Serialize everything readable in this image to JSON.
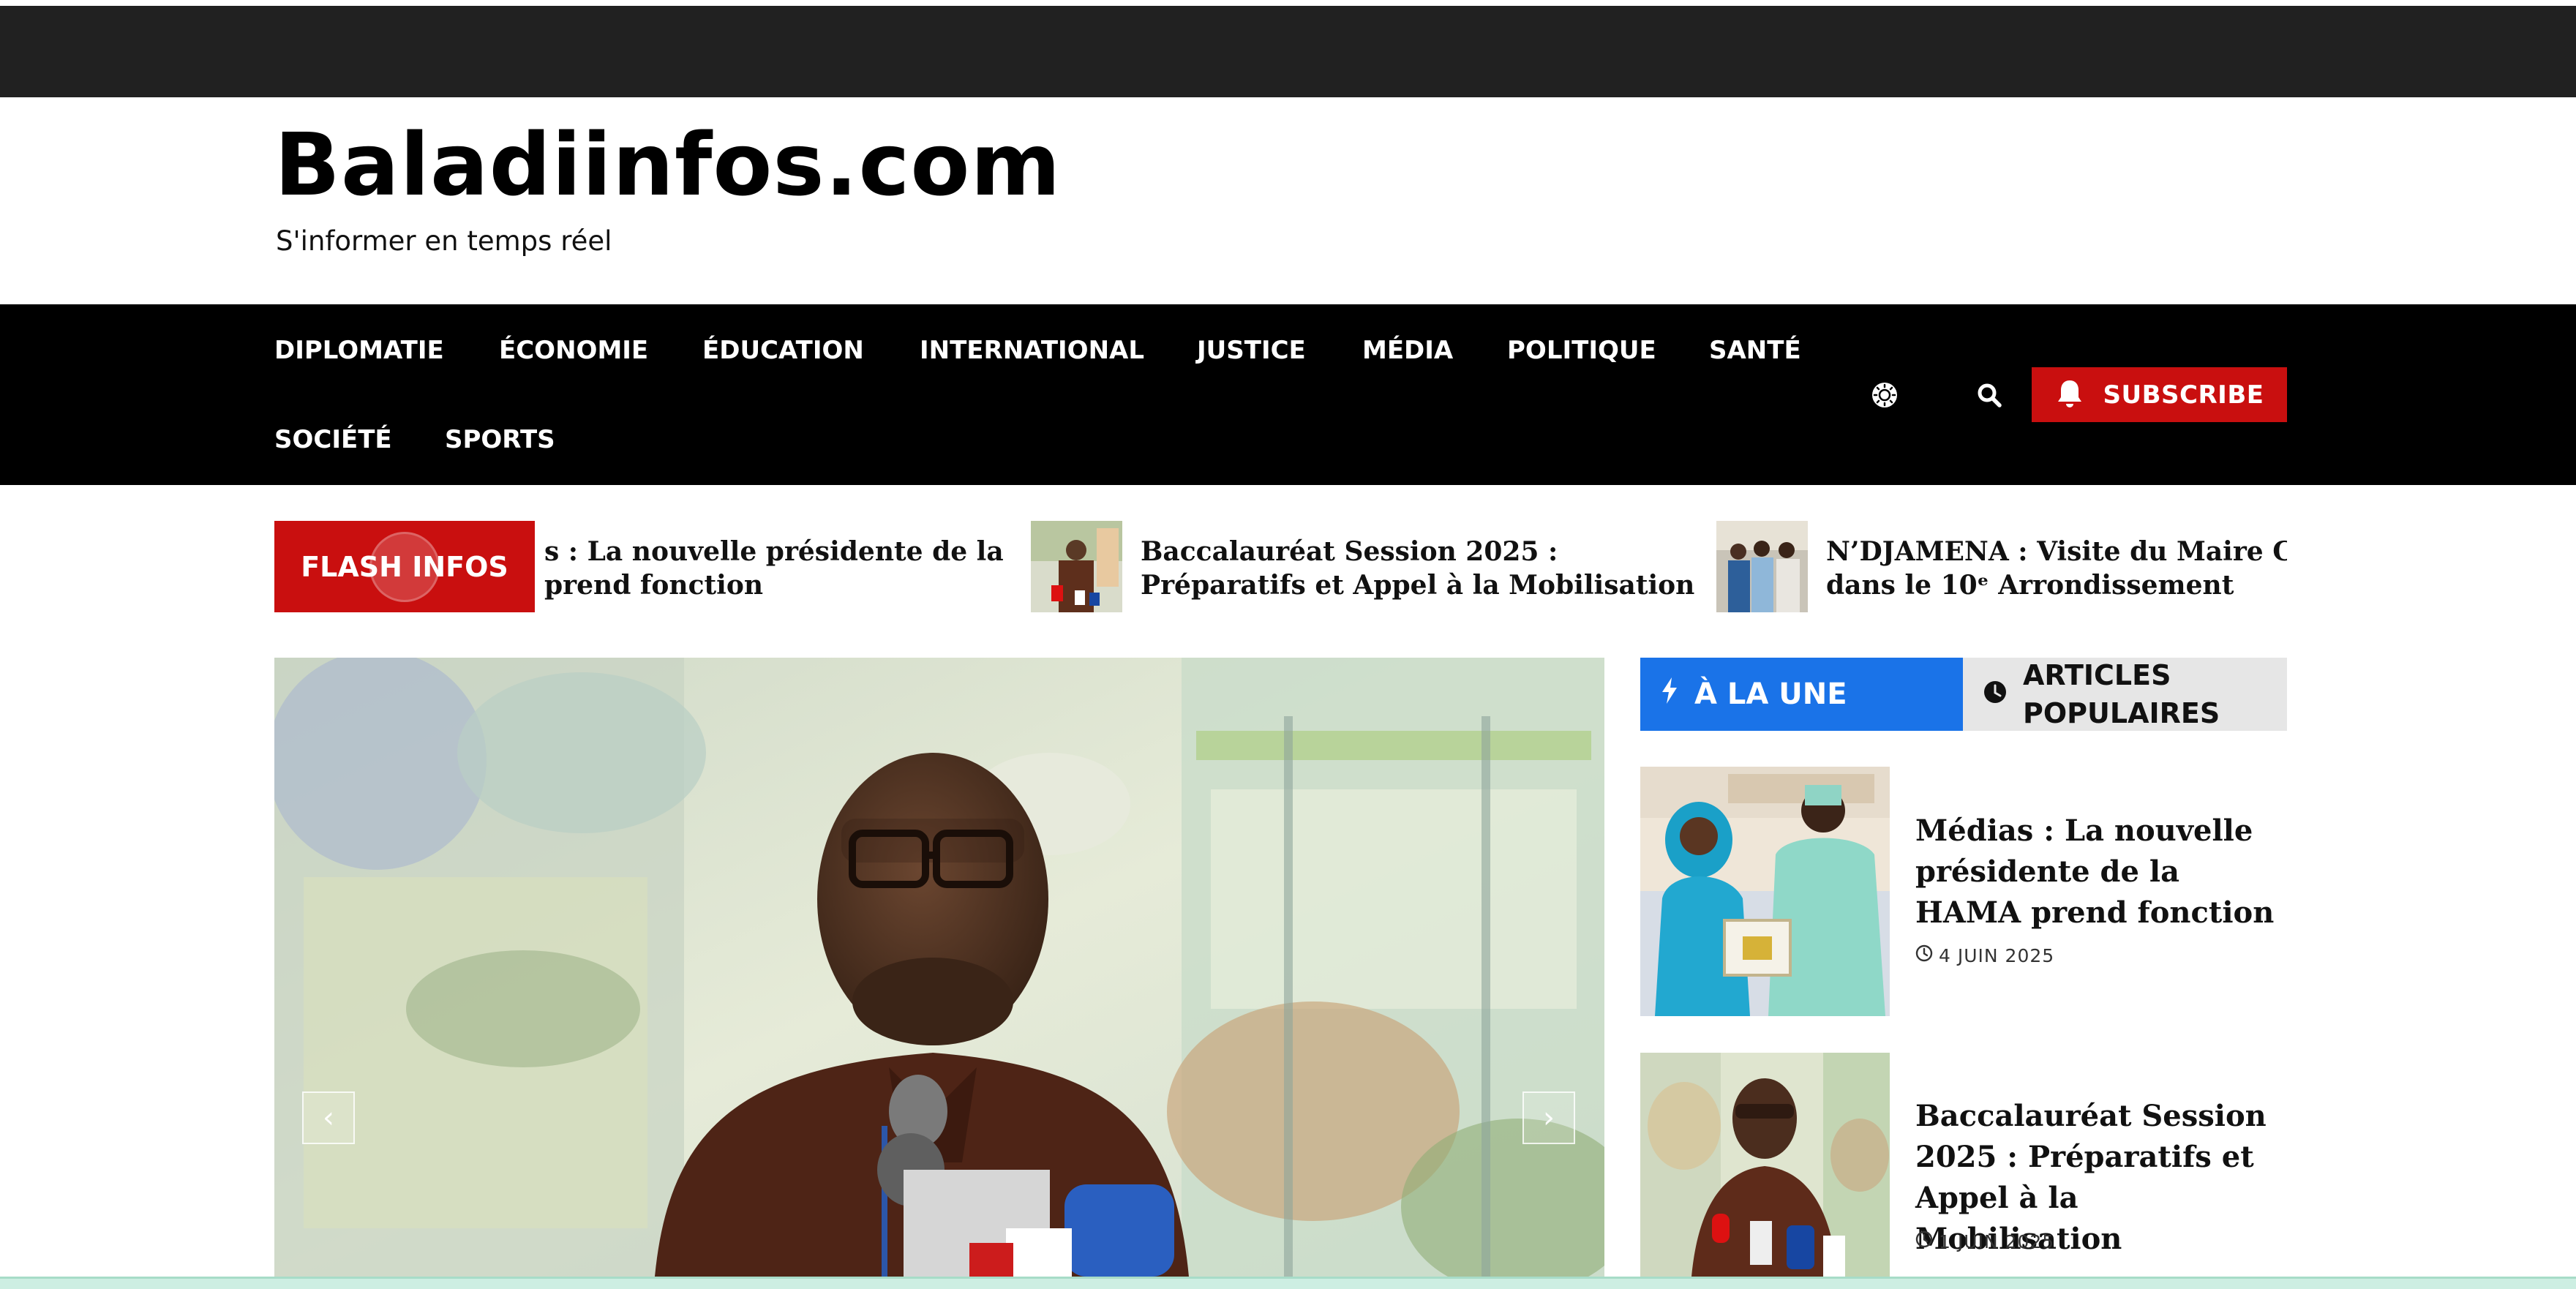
{
  "site": {
    "title": "Baladiinfos.com",
    "tagline": "S'informer en temps réel"
  },
  "nav": {
    "items": [
      "DIPLOMATIE",
      "ÉCONOMIE",
      "ÉDUCATION",
      "INTERNATIONAL",
      "JUSTICE",
      "MÉDIA",
      "POLITIQUE",
      "SANTÉ",
      "SOCIÉTÉ",
      "SPORTS"
    ],
    "theme_icon": "sun-icon",
    "search_icon": "search-icon",
    "subscribe_icon": "bell-icon",
    "subscribe_label": "SUBSCRIBE"
  },
  "flash": {
    "label": "FLASH INFOS",
    "items": [
      {
        "line1": "s : La nouvelle présidente de la",
        "line2": "prend fonction"
      },
      {
        "line1": "Baccalauréat Session 2025 :",
        "line2": "Préparatifs et Appel à la Mobilisation"
      },
      {
        "line1": "N’DJAMENA : Visite du Maire Central",
        "line2": "dans le 10ᵉ Arrondissement"
      }
    ]
  },
  "slider": {
    "prev_icon": "chevron-left-icon",
    "next_icon": "chevron-right-icon"
  },
  "sidebar": {
    "tab_active": "À LA UNE",
    "tab_active_icon": "bolt-icon",
    "tab_inactive": "ARTICLES POPULAIRES",
    "tab_inactive_icon": "clock-icon",
    "articles": [
      {
        "title": "Médias : La nouvelle présidente de la HAMA prend fonction",
        "date": "4 JUIN 2025"
      },
      {
        "title": "Baccalauréat Session 2025 : Préparatifs et Appel à la Mobilisation",
        "date": "1 JUIN 2025"
      }
    ]
  },
  "colors": {
    "accent_red": "#c90f0f",
    "accent_blue": "#1a73e8",
    "nav_bg": "#000000",
    "topbar_bg": "#212121"
  }
}
